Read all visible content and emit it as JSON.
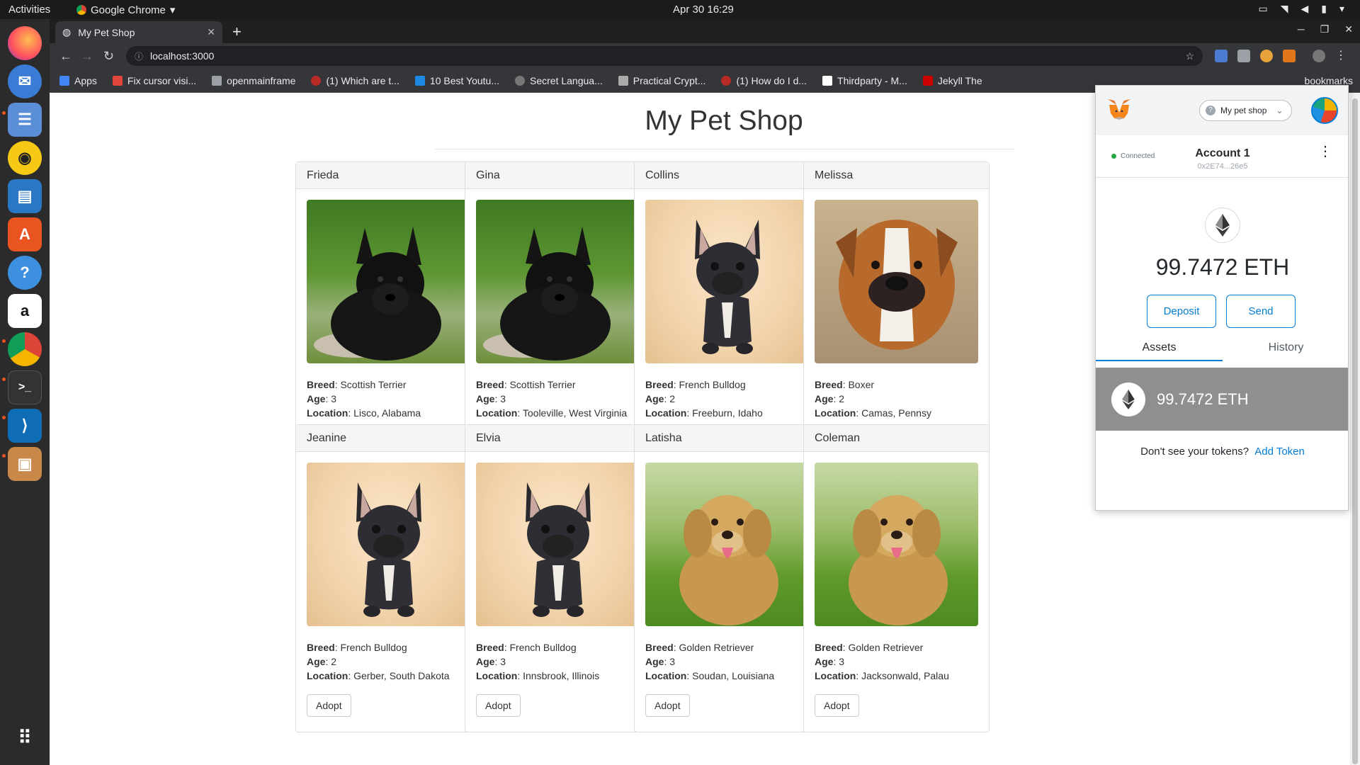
{
  "system": {
    "activities": "Activities",
    "app_name": "Google Chrome",
    "clock": "Apr 30  16:29"
  },
  "browser": {
    "tab_title": "My Pet Shop",
    "url": "localhost:3000",
    "bookmarks": [
      {
        "label": "Apps",
        "color": "#4285f4"
      },
      {
        "label": "Fix cursor visi...",
        "color": "#e2453c"
      },
      {
        "label": "openmainframe",
        "color": "#9aa0a6"
      },
      {
        "label": "(1) Which are t...",
        "color": "#b92b27"
      },
      {
        "label": "10 Best Youtu...",
        "color": "#1e88e5"
      },
      {
        "label": "Secret Langua...",
        "color": "#777777"
      },
      {
        "label": "Practical Crypt...",
        "color": "#aaaaaa"
      },
      {
        "label": "(1) How do I d...",
        "color": "#b92b27"
      },
      {
        "label": "Thirdparty - M...",
        "color": "#ffffff"
      },
      {
        "label": "Jekyll The",
        "color": "#cc0000"
      }
    ],
    "bookmarks_right": "bookmarks"
  },
  "shop": {
    "title": "My Pet Shop",
    "field_breed": "Breed",
    "field_age": "Age",
    "field_location": "Location",
    "adopt_label": "Adopt",
    "pets": [
      {
        "name": "Frieda",
        "breed": "Scottish Terrier",
        "age": "3",
        "location": "Lisco, Alabama",
        "kind": "terrier"
      },
      {
        "name": "Gina",
        "breed": "Scottish Terrier",
        "age": "3",
        "location": "Tooleville, West Virginia",
        "kind": "terrier"
      },
      {
        "name": "Collins",
        "breed": "French Bulldog",
        "age": "2",
        "location": "Freeburn, Idaho",
        "kind": "frenchie"
      },
      {
        "name": "Melissa",
        "breed": "Boxer",
        "age": "2",
        "location": "Camas, Pennsy",
        "kind": "boxer"
      },
      {
        "name": "Jeanine",
        "breed": "French Bulldog",
        "age": "2",
        "location": "Gerber, South Dakota",
        "kind": "frenchie"
      },
      {
        "name": "Elvia",
        "breed": "French Bulldog",
        "age": "3",
        "location": "Innsbrook, Illinois",
        "kind": "frenchie"
      },
      {
        "name": "Latisha",
        "breed": "Golden Retriever",
        "age": "3",
        "location": "Soudan, Louisiana",
        "kind": "golden"
      },
      {
        "name": "Coleman",
        "breed": "Golden Retriever",
        "age": "3",
        "location": "Jacksonwald, Palau",
        "kind": "golden"
      }
    ]
  },
  "metamask": {
    "network": "My pet shop",
    "status": "Connected",
    "account_name": "Account 1",
    "address": "0x2E74...26e5",
    "balance": "99.7472 ETH",
    "deposit_label": "Deposit",
    "send_label": "Send",
    "tab_assets": "Assets",
    "tab_history": "History",
    "asset_balance": "99.7472 ETH",
    "tokens_prompt": "Don't see your tokens?",
    "add_token": "Add Token",
    "accent": "#037dd6"
  }
}
